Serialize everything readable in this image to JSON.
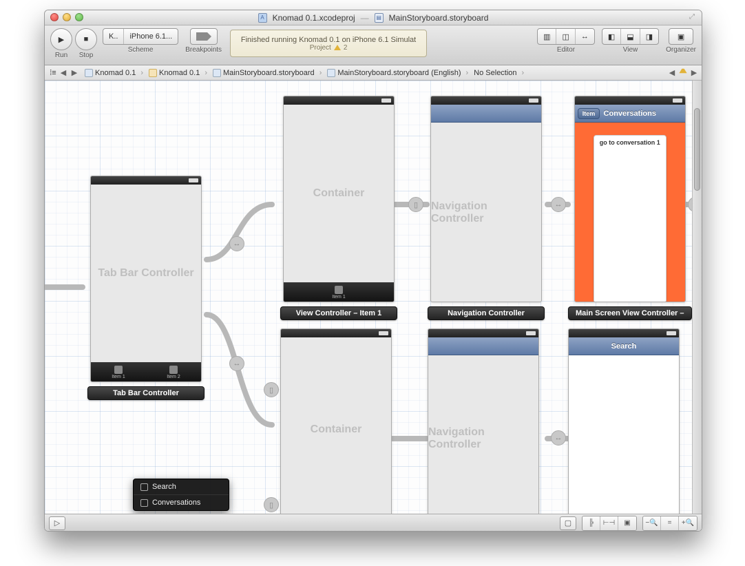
{
  "title": {
    "doc1": "Knomad 0.1.xcodeproj",
    "doc2": "MainStoryboard.storyboard"
  },
  "toolbar": {
    "run": "Run",
    "stop": "Stop",
    "scheme": "Scheme",
    "scheme_target": "K..",
    "scheme_device": "iPhone 6.1...",
    "breakpoints": "Breakpoints",
    "lcd_main": "Finished running Knomad 0.1 on iPhone 6.1 Simulat",
    "lcd_sub_label": "Project",
    "lcd_sub_count": "2",
    "editor": "Editor",
    "view": "View",
    "organizer": "Organizer"
  },
  "jumpbar": {
    "items": [
      {
        "icon": "proj",
        "text": "Knomad 0.1"
      },
      {
        "icon": "folder",
        "text": "Knomad 0.1"
      },
      {
        "icon": "sb",
        "text": "MainStoryboard.storyboard"
      },
      {
        "icon": "sb",
        "text": "MainStoryboard.storyboard (English)"
      },
      {
        "icon": "",
        "text": "No Selection"
      }
    ]
  },
  "scenes": {
    "tabbar": {
      "title": "Tab Bar Controller",
      "tabs": [
        "Item 1",
        "Item 2"
      ],
      "label": "Tab Bar Controller"
    },
    "container1": {
      "title": "Container",
      "tab_item": "Item 1",
      "label": "View Controller – Item 1"
    },
    "nav1": {
      "title": "Navigation Controller",
      "label": "Navigation Controller"
    },
    "conversations": {
      "navtitle": "Conversations",
      "back": "Item",
      "button": "go to conversation 1",
      "label": "Main Screen View Controller –"
    },
    "container2": {
      "title": "Container"
    },
    "nav2": {
      "title": "Navigation Controller"
    },
    "search": {
      "navtitle": "Search"
    }
  },
  "context_menu": {
    "items": [
      "Search",
      "Conversations"
    ]
  }
}
